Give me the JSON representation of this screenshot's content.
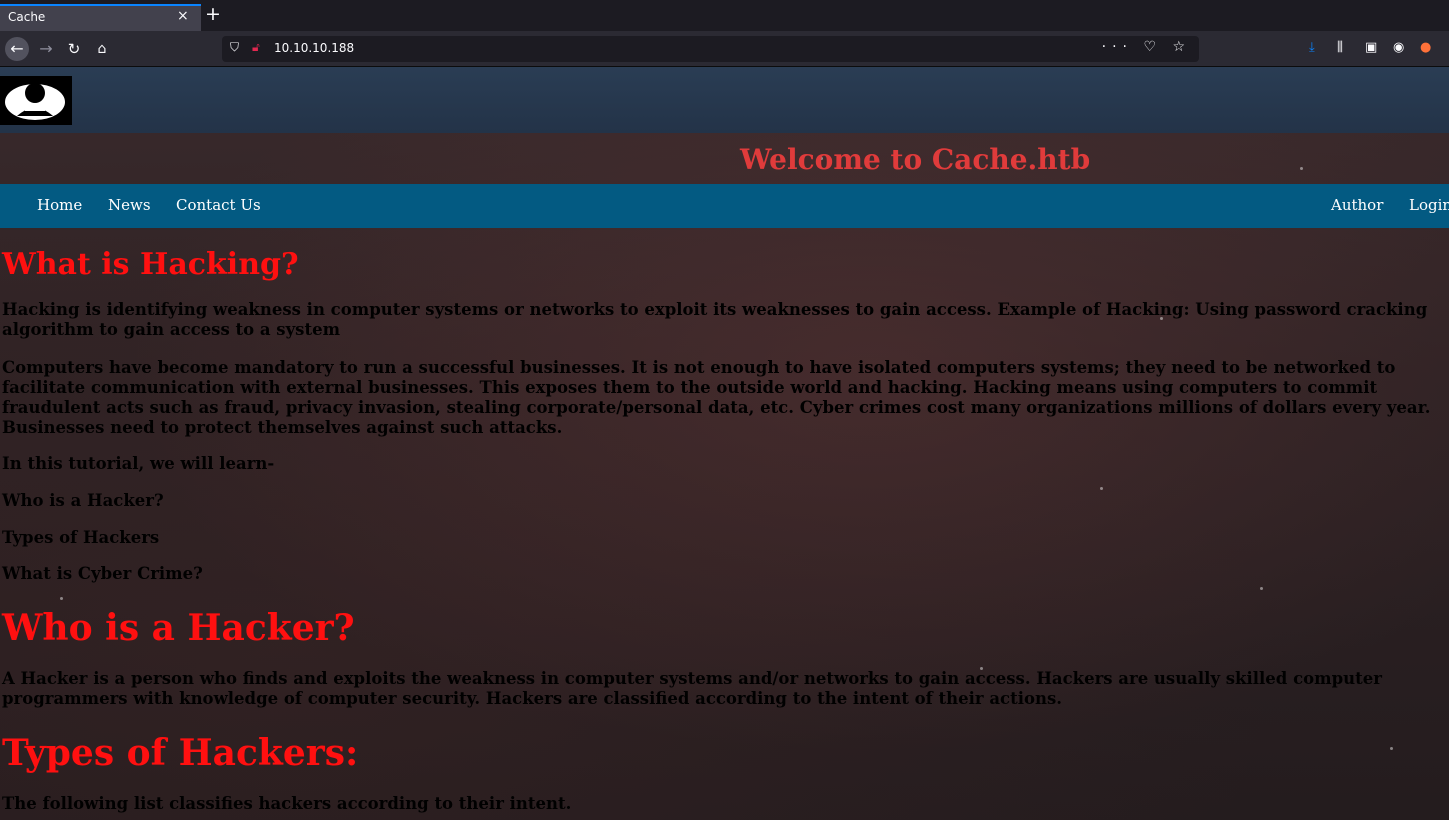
{
  "browser": {
    "tab_title": "Cache",
    "tab_close": "×",
    "new_tab": "+",
    "url": "10.10.10.188",
    "url_actions": "··· ♡ ☆"
  },
  "site": {
    "welcome": "Welcome to Cache.htb",
    "nav_left": [
      "Home",
      "News",
      "Contact Us"
    ],
    "nav_right": [
      "Author",
      "Login"
    ]
  },
  "article": {
    "heading1": "What is Hacking?",
    "para1": "Hacking is identifying weakness in computer systems or networks to exploit its weaknesses to gain access. Example of Hacking: Using password cracking algorithm to gain access to a system",
    "para2": "Computers have become mandatory to run a successful businesses. It is not enough to have isolated computers systems; they need to be networked to facilitate communication with external businesses. This exposes them to the outside world and hacking. Hacking means using computers to commit fraudulent acts such as fraud, privacy invasion, stealing corporate/personal data, etc. Cyber crimes cost many organizations millions of dollars every year. Businesses need to protect themselves against such attacks.",
    "para3": "In this tutorial, we will learn-",
    "list": [
      "Who is a Hacker?",
      "Types of Hackers",
      "What is Cyber Crime?"
    ],
    "heading2": "Who is a Hacker?",
    "para4": "A Hacker is a person who finds and exploits the weakness in computer systems and/or networks to gain access. Hackers are usually skilled computer programmers with knowledge of computer security. Hackers are classified according to the intent of their actions.",
    "heading3": "Types of Hackers:",
    "para5": "The following list classifies hackers according to their intent."
  },
  "colors": {
    "heading_red": "#ff1010",
    "welcome_red": "#e03b3b",
    "menu_blue": "#035a82"
  }
}
